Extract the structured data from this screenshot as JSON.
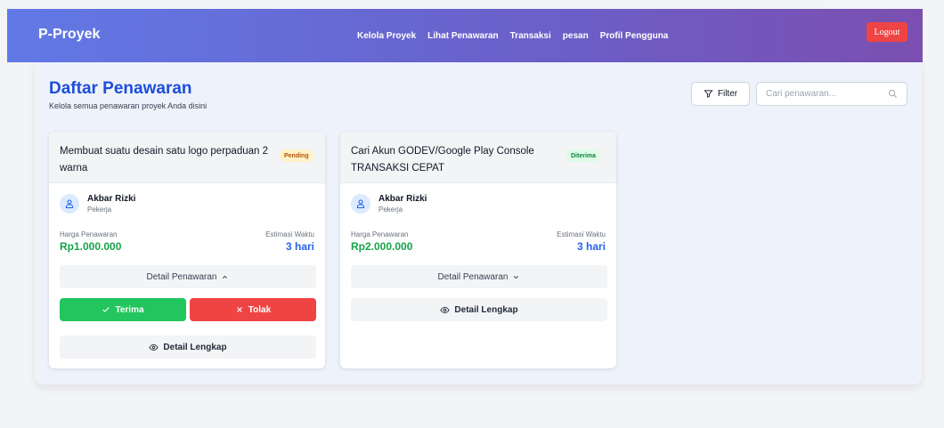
{
  "navbar": {
    "brand": "P-Proyek",
    "links": [
      "Kelola Proyek",
      "Lihat Penawaran",
      "Transaksi",
      "pesan",
      "Profil Pengguna"
    ],
    "logout_label": "Logout"
  },
  "page": {
    "title": "Daftar Penawaran",
    "subtitle": "Kelola semua penawaran proyek Anda disini",
    "filter_label": "Filter",
    "search_placeholder": "Cari penawaran..."
  },
  "labels": {
    "price_label": "Harga Penawaran",
    "estimate_label": "Estimasi Waktu",
    "detail_offer": "Detail Penawaran",
    "accept": "Terima",
    "reject": "Tolak",
    "full_detail": "Detail Lengkap"
  },
  "cards": [
    {
      "title": "Membuat suatu desain satu logo perpaduan 2 warna",
      "status": "Pending",
      "worker_name": "Akbar Rizki",
      "worker_role": "Pekerja",
      "price": "Rp1.000.000",
      "estimate": "3 hari",
      "expanded": true
    },
    {
      "title": "Cari Akun GODEV/Google Play Console TRANSAKSI CEPAT",
      "status": "Diterima",
      "worker_name": "Akbar Rizki",
      "worker_role": "Pekerja",
      "price": "Rp2.000.000",
      "estimate": "3 hari",
      "expanded": false
    }
  ],
  "colors": {
    "accent_blue": "#1d4ed8",
    "green": "#16a34a",
    "red": "#ef4444"
  }
}
